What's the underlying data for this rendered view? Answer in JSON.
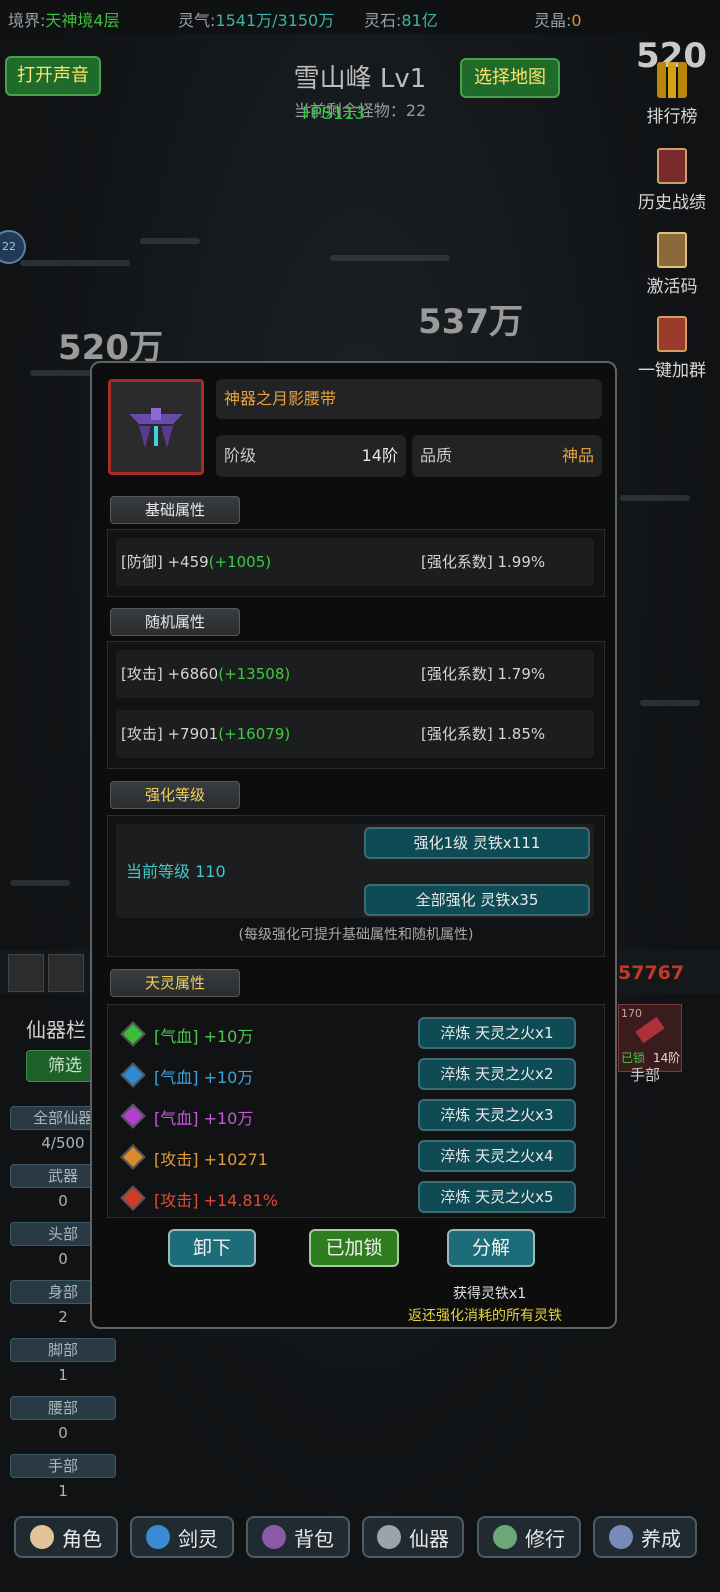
{
  "topbar": {
    "realm_label": "境界:",
    "realm_value": "天神境4层",
    "qi_label": "灵气:",
    "qi_value": "1541万/3150万",
    "stone_label": "灵石:",
    "stone_value": "81亿",
    "crystal_label": "灵晶:",
    "crystal_value": "0"
  },
  "header": {
    "sound_button": "打开声音",
    "map_title": "雪山峰 Lv1",
    "monsters_left": "当前剩余怪物：22",
    "fps": "FPS113",
    "select_map_button": "选择地图",
    "level_badge": "22"
  },
  "sidebar": [
    {
      "label": "排行榜",
      "icon": "ranking-icon"
    },
    {
      "label": "历史战绩",
      "icon": "history-book-icon"
    },
    {
      "label": "激活码",
      "icon": "code-book-icon"
    },
    {
      "label": "一键加群",
      "icon": "group-join-icon"
    }
  ],
  "battle_numbers": [
    "520万",
    "537万",
    "520"
  ],
  "item": {
    "name": "神器之月影腰带",
    "grade_label": "阶级",
    "grade_value": "14阶",
    "quality_label": "品质",
    "quality_value": "神品"
  },
  "sections": {
    "base": "基础属性",
    "random": "随机属性",
    "enhance": "强化等级",
    "celestial": "天灵属性"
  },
  "base_attrs": [
    {
      "stat": "[防御] +459",
      "bonus": "(+1005)",
      "coef": "[强化系数] 1.99%"
    }
  ],
  "random_attrs": [
    {
      "stat": "[攻击] +6860",
      "bonus": "(+13508)",
      "coef": "[强化系数] 1.79%"
    },
    {
      "stat": "[攻击] +7901",
      "bonus": "(+16079)",
      "coef": "[强化系数] 1.85%"
    }
  ],
  "enhance": {
    "current_level": "当前等级 110",
    "btn_one": "强化1级 灵铁x111",
    "btn_all": "全部强化 灵铁x35",
    "note": "(每级强化可提升基础属性和随机属性)"
  },
  "celestial_attrs": [
    {
      "text": "[气血] +10万",
      "color": "#4cc84c",
      "gem": "#3bbf3b",
      "btn": "淬炼 天灵之火x1"
    },
    {
      "text": "[气血] +10万",
      "color": "#3aa6e0",
      "gem": "#2d8ad6",
      "btn": "淬炼 天灵之火x2"
    },
    {
      "text": "[气血] +10万",
      "color": "#c45ad8",
      "gem": "#b23fd0",
      "btn": "淬炼 天灵之火x3"
    },
    {
      "text": "[攻击] +10271",
      "color": "#e09a3a",
      "gem": "#d98a2a",
      "btn": "淬炼 天灵之火x4"
    },
    {
      "text": "[攻击] +14.81%",
      "color": "#e04a3a",
      "gem": "#d23a2a",
      "btn": "淬炼 天灵之火x5"
    }
  ],
  "actions": {
    "unequip": "卸下",
    "locked": "已加锁",
    "decompose": "分解",
    "gain": "获得灵铁x1",
    "refund": "返还强化消耗的所有灵铁"
  },
  "backpanel": {
    "title": "仙器栏",
    "filter": "筛选",
    "right_number": "57767",
    "right_item_count": "170",
    "right_item_locked": "已锁",
    "right_item_grade": "14阶",
    "right_item_slot": "手部",
    "categories": [
      {
        "label": "全部仙器",
        "value": "4/500"
      },
      {
        "label": "武器",
        "value": "0"
      },
      {
        "label": "头部",
        "value": "0"
      },
      {
        "label": "身部",
        "value": "2"
      },
      {
        "label": "脚部",
        "value": "1"
      },
      {
        "label": "腰部",
        "value": "0"
      },
      {
        "label": "手部",
        "value": "1"
      }
    ]
  },
  "bottom_nav": [
    {
      "label": "角色",
      "icon": "character-icon"
    },
    {
      "label": "剑灵",
      "icon": "sword-spirit-icon"
    },
    {
      "label": "背包",
      "icon": "bag-icon"
    },
    {
      "label": "仙器",
      "icon": "artifact-icon"
    },
    {
      "label": "修行",
      "icon": "cultivation-icon"
    },
    {
      "label": "养成",
      "icon": "nurture-icon"
    }
  ]
}
